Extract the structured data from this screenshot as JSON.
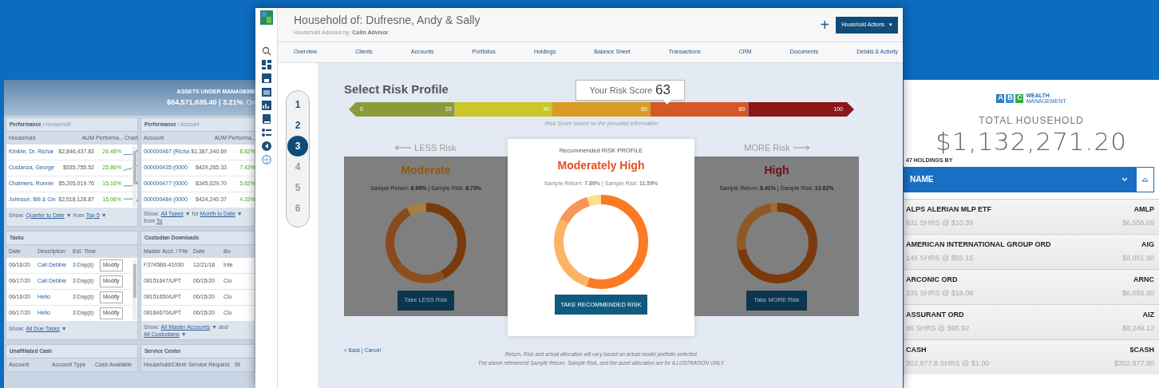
{
  "dashboard": {
    "aum_label": "ASSETS UNDER MANAGEME",
    "aum_value": "$64,571,635.40 | 3.21%",
    "aum_suffix": "Ov",
    "panels": [
      {
        "title": "Performance",
        "subtitle": "/ Household",
        "columns": [
          "Household",
          "AUM",
          "Performa...",
          "Chart"
        ],
        "rows": [
          [
            {
              "kind": "link",
              "text": "Kimble, Dr. Richar"
            },
            {
              "kind": "text",
              "text": "$2,846,437.83"
            },
            {
              "kind": "gain",
              "text": "26.48%"
            },
            {
              "kind": "sparkline"
            }
          ],
          [
            {
              "kind": "link",
              "text": "Costanza, George"
            },
            {
              "kind": "text",
              "text": "$535,755.52"
            },
            {
              "kind": "gain",
              "text": "25.86%"
            },
            {
              "kind": "sparkline"
            }
          ],
          [
            {
              "kind": "link",
              "text": "Chalmers, Ronnie"
            },
            {
              "kind": "text",
              "text": "$5,205,019.76"
            },
            {
              "kind": "gain",
              "text": "15.16%"
            },
            {
              "kind": "sparkline"
            }
          ],
          [
            {
              "kind": "link",
              "text": "Johnson, Bill & Cin"
            },
            {
              "kind": "text",
              "text": "$2,518,128.87"
            },
            {
              "kind": "gain",
              "text": "15.06%"
            },
            {
              "kind": "sparkline"
            }
          ]
        ],
        "footer": [
          {
            "kind": "label",
            "text": "Show:"
          },
          {
            "kind": "link",
            "text": "Quarter to Date"
          },
          {
            "kind": "label",
            "text": "▼"
          },
          {
            "kind": "label",
            "text": "from"
          },
          {
            "kind": "link",
            "text": "Top 5"
          },
          {
            "kind": "label",
            "text": "▼"
          }
        ]
      },
      {
        "title": "Performance",
        "subtitle": "/ Account",
        "columns": [
          "Account",
          "AUM",
          "Performa..."
        ],
        "rows": [
          [
            {
              "kind": "link",
              "text": "000000467 (Richa"
            },
            {
              "kind": "text",
              "text": "$1,387,340.69"
            },
            {
              "kind": "gain",
              "text": "8.82%"
            }
          ],
          [
            {
              "kind": "link",
              "text": "000000435 (0000"
            },
            {
              "kind": "text",
              "text": "$429,265.33"
            },
            {
              "kind": "gain",
              "text": "7.43%"
            }
          ],
          [
            {
              "kind": "link",
              "text": "000000477 (0000"
            },
            {
              "kind": "text",
              "text": "$345,029.70"
            },
            {
              "kind": "gain",
              "text": "5.82%"
            }
          ],
          [
            {
              "kind": "link",
              "text": "000000484 (0000"
            },
            {
              "kind": "text",
              "text": "$424,240.37"
            },
            {
              "kind": "gain",
              "text": "4.33%"
            }
          ]
        ],
        "footer": [
          {
            "kind": "label",
            "text": "Show:"
          },
          {
            "kind": "link",
            "text": "All Types"
          },
          {
            "kind": "label",
            "text": "▼"
          },
          {
            "kind": "label",
            "text": "for"
          },
          {
            "kind": "link",
            "text": "Month to Date"
          },
          {
            "kind": "label",
            "text": "▼"
          },
          {
            "kind": "label",
            "text": "from"
          },
          {
            "kind": "link",
            "text": "To"
          }
        ]
      },
      {
        "title": "Tasks",
        "columns": [
          "Date",
          "Description",
          "Est. Time",
          ""
        ],
        "rows": [
          [
            {
              "kind": "text",
              "text": "06/16/20"
            },
            {
              "kind": "link",
              "text": "Call Debbie"
            },
            {
              "kind": "text",
              "text": "3 Day(s)"
            },
            {
              "kind": "button",
              "text": "Modify"
            }
          ],
          [
            {
              "kind": "text",
              "text": "06/17/20"
            },
            {
              "kind": "link",
              "text": "Call Debbie"
            },
            {
              "kind": "text",
              "text": "3 Day(s)"
            },
            {
              "kind": "button",
              "text": "Modify"
            }
          ],
          [
            {
              "kind": "text",
              "text": "06/16/20"
            },
            {
              "kind": "link",
              "text": "Hello"
            },
            {
              "kind": "text",
              "text": "3 Day(s)"
            },
            {
              "kind": "button",
              "text": "Modify"
            }
          ],
          [
            {
              "kind": "text",
              "text": "06/17/20"
            },
            {
              "kind": "link",
              "text": "Hello"
            },
            {
              "kind": "text",
              "text": "3 Day(s)"
            },
            {
              "kind": "button",
              "text": "Modify"
            }
          ]
        ],
        "footer": [
          {
            "kind": "label",
            "text": "Show:"
          },
          {
            "kind": "link",
            "text": "All Due Tasks"
          },
          {
            "kind": "label",
            "text": "▼"
          }
        ]
      },
      {
        "title": "Custodian Downloads",
        "columns": [
          "Master Acct. / File",
          "Date",
          "Bo"
        ],
        "rows": [
          [
            {
              "kind": "text",
              "text": "F3745B6-41030"
            },
            {
              "kind": "text",
              "text": "12/21/18"
            },
            {
              "kind": "text",
              "text": "Inte"
            }
          ],
          [
            {
              "kind": "text",
              "text": "08151647/UPT"
            },
            {
              "kind": "text",
              "text": "06/15/20"
            },
            {
              "kind": "text",
              "text": "Clo"
            }
          ],
          [
            {
              "kind": "text",
              "text": "08151650/UPT"
            },
            {
              "kind": "text",
              "text": "06/15/20"
            },
            {
              "kind": "text",
              "text": "Clo"
            }
          ],
          [
            {
              "kind": "text",
              "text": "08184670/UPT"
            },
            {
              "kind": "text",
              "text": "06/15/20"
            },
            {
              "kind": "text",
              "text": "Clo"
            }
          ]
        ],
        "footer": [
          {
            "kind": "label",
            "text": "Show:"
          },
          {
            "kind": "link",
            "text": "All Master Accounts"
          },
          {
            "kind": "label",
            "text": "▼"
          },
          {
            "kind": "label",
            "text": "and"
          },
          {
            "kind": "link",
            "text": "All Custodians"
          },
          {
            "kind": "label",
            "text": "▼"
          }
        ]
      },
      {
        "title": "Unaffiliated Cash",
        "columns": [
          "Account",
          "Account Type",
          "Cash Available"
        ]
      },
      {
        "title": "Service Center",
        "columns": [
          "Household/Client",
          "Service Request",
          "St"
        ]
      }
    ]
  },
  "window": {
    "title": "Household of: Dufresne, Andy & Sally",
    "advised_by_label": "Household Advised by:",
    "advisor": "Colin Advisor",
    "add_button": "+",
    "actions_button": "Household Actions",
    "actions_caret": "▾",
    "nav": [
      "Overview",
      "Clients",
      "Accounts",
      "Portfolios",
      "Holdings",
      "Balance Sheet",
      "Transactions",
      "CRM",
      "Documents",
      "Details & Activity"
    ]
  },
  "steps": [
    {
      "label": "1",
      "completed": true,
      "selected": false
    },
    {
      "label": "2",
      "completed": true,
      "selected": false
    },
    {
      "label": "3",
      "completed": true,
      "selected": true
    },
    {
      "label": "4",
      "completed": false,
      "selected": false
    },
    {
      "label": "5",
      "completed": false,
      "selected": false
    },
    {
      "label": "6",
      "completed": false,
      "selected": false
    }
  ],
  "risk": {
    "heading": "Select Risk Profile",
    "score_label": "Your Risk Score",
    "score": "63",
    "level": 0.63,
    "scale": [
      {
        "start": "0",
        "end": "20",
        "color": "#8c9b3a"
      },
      {
        "end": "40",
        "color": "#cbc62a"
      },
      {
        "end": "60",
        "color": "#d99a26"
      },
      {
        "end": "80",
        "color": "#d5582b"
      },
      {
        "end": "100",
        "color": "#8e1515"
      }
    ],
    "scale_caption": "Risk Score based on the provided information",
    "profiles": [
      {
        "kind": "less",
        "heading": "LESS Risk",
        "title": "Moderate",
        "color": "#8a5a12",
        "stats": "Sample Return: **6.99%** | Sample Risk: **8.73%**",
        "button": "Take LESS Risk"
      },
      {
        "kind": "recommended",
        "heading": "Recommended RISK PROFILE",
        "title": "Moderately High",
        "color": "#e0521f",
        "stats": "Sample Return: **7.86%** | Sample Risk: **11.59%**",
        "button": "TAKE RECOMMENDED RISK"
      },
      {
        "kind": "more",
        "heading": "MORE Risk",
        "title": "High",
        "color": "#6e1010",
        "stats": "Sample Return: **8.41%** | Sample Risk: **13.82%**",
        "button": "Take MORE Risk"
      }
    ],
    "back": "< Back",
    "separator": "|",
    "cancel": "Cancel",
    "disclaimer": [
      "Return, Risk and actual allocation will vary based on actual model portfolio selected.",
      "The above referenced Sample Return, Sample Risk, and the asset allocation are for ILLUSTRATION ONLY."
    ]
  },
  "mobile": {
    "logo_letters": [
      "A",
      "B",
      "C"
    ],
    "logo_line1": "WEALTH",
    "logo_line2": "MANAGEMENT",
    "total_label": "TOTAL HOUSEHOLD",
    "total": "$1,132,271.20",
    "holdings_label": "47 HOLDINGS BY",
    "sort_by": "NAME",
    "holdings": [
      {
        "name": "ALPS ALERIAN MLP ETF",
        "ticker": "AMLP",
        "shares": "631 SHRS @ $10.39",
        "value": "$6,556.09"
      },
      {
        "name": "AMERICAN INTERNATIONAL GROUP ORD",
        "ticker": "AIG",
        "shares": "146 SHRS @ $55.15",
        "value": "$8,051.90"
      },
      {
        "name": "ARCONIC ORD",
        "ticker": "ARNC",
        "shares": "335 SHRS @ $18.08",
        "value": "$6,056.80"
      },
      {
        "name": "ASSURANT ORD",
        "ticker": "AIZ",
        "shares": "86 SHRS @ $95.92",
        "value": "$8,249.12"
      },
      {
        "name": "CASH",
        "ticker": "$CASH",
        "shares": "302,877.8 SHRS @ $1.00",
        "value": "$302,877.80"
      }
    ]
  }
}
